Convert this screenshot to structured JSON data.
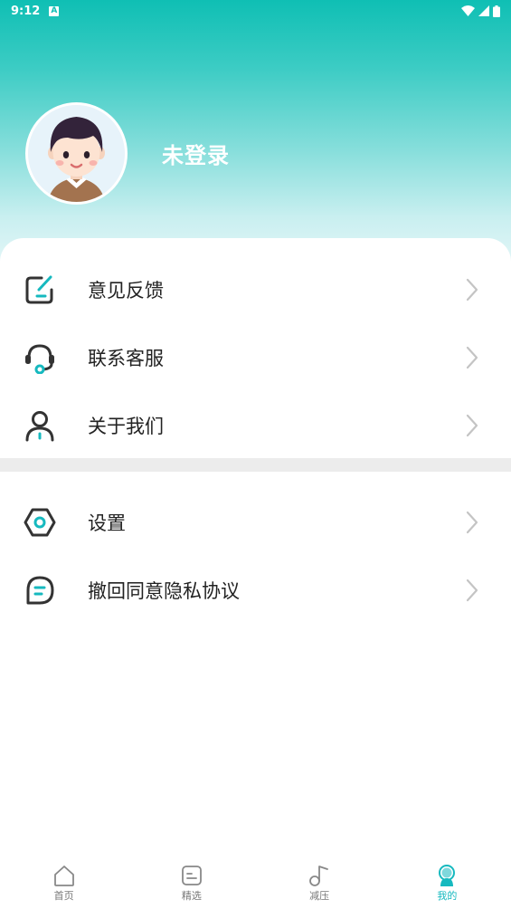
{
  "status_bar": {
    "time": "9:12",
    "notification_letter": "A"
  },
  "profile": {
    "username": "未登录"
  },
  "menu_group_1": [
    {
      "id": "feedback",
      "label": "意见反馈",
      "icon": "edit-square-icon"
    },
    {
      "id": "customer-service",
      "label": "联系客服",
      "icon": "headset-icon"
    },
    {
      "id": "about-us",
      "label": "关于我们",
      "icon": "user-icon"
    }
  ],
  "menu_group_2": [
    {
      "id": "settings",
      "label": "设置",
      "icon": "settings-hexagon-icon"
    },
    {
      "id": "revoke-privacy",
      "label": "撤回同意隐私协议",
      "icon": "chat-bubble-icon"
    }
  ],
  "bottom_nav": [
    {
      "id": "home",
      "label": "首页",
      "icon": "home-icon",
      "active": false
    },
    {
      "id": "featured",
      "label": "精选",
      "icon": "note-icon",
      "active": false
    },
    {
      "id": "relax",
      "label": "减压",
      "icon": "music-note-icon",
      "active": false
    },
    {
      "id": "mine",
      "label": "我的",
      "icon": "profile-icon",
      "active": true
    }
  ],
  "colors": {
    "accent": "#16b9bf",
    "header_top": "#0fbfb4",
    "icon_dark": "#333333",
    "chevron": "#c4c4c4"
  }
}
